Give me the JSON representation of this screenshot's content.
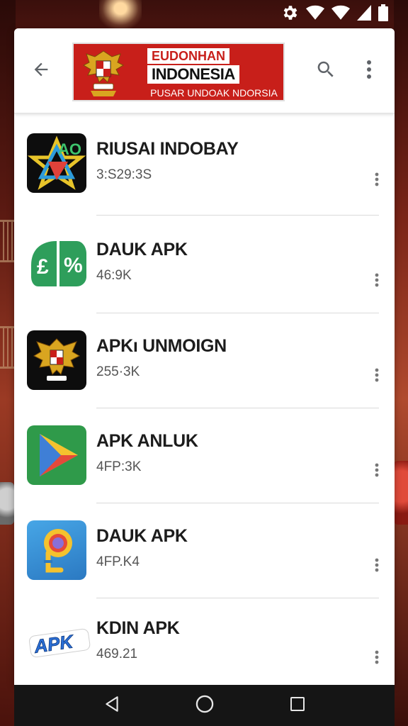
{
  "status_bar": {
    "icons": [
      "settings-icon",
      "wifi-icon",
      "wifi-icon",
      "signal-icon",
      "battery-icon"
    ]
  },
  "header": {
    "back_icon": "arrow-back-icon",
    "banner": {
      "line1": "EUDONHAN",
      "line2": "INDONESIA",
      "line3": "PUSAR UNDOAK NDORSIA",
      "emblem": "garuda-emblem"
    },
    "search_icon": "search-icon",
    "more_icon": "more-vert-icon"
  },
  "apps": [
    {
      "title": "RIUSAI INDOBAY",
      "subtitle": "3:S29:3S",
      "icon": "star-logo-icon"
    },
    {
      "title": "DAUK APK",
      "subtitle": "46:9K",
      "icon": "green-apk-icon"
    },
    {
      "title": "APKı UNMOIGN",
      "subtitle": "255·3K",
      "icon": "garuda-icon"
    },
    {
      "title": "APK ANLUK",
      "subtitle": "4FP:3K",
      "icon": "play-triangle-icon"
    },
    {
      "title": "DAUK APK",
      "subtitle": "4FP.K4",
      "icon": "blue-pin-icon"
    },
    {
      "title": "KDIN APK",
      "subtitle": "469.21",
      "icon": "apk-wordmark-icon",
      "icon_text": "APK"
    }
  ],
  "nav_bar": {
    "icons": [
      "nav-back-icon",
      "nav-home-icon",
      "nav-recents-icon"
    ]
  },
  "colors": {
    "banner_red": "#c81f1a",
    "nav_bg": "#151515",
    "title_text": "#1c1c1c",
    "sub_text": "#555555"
  }
}
